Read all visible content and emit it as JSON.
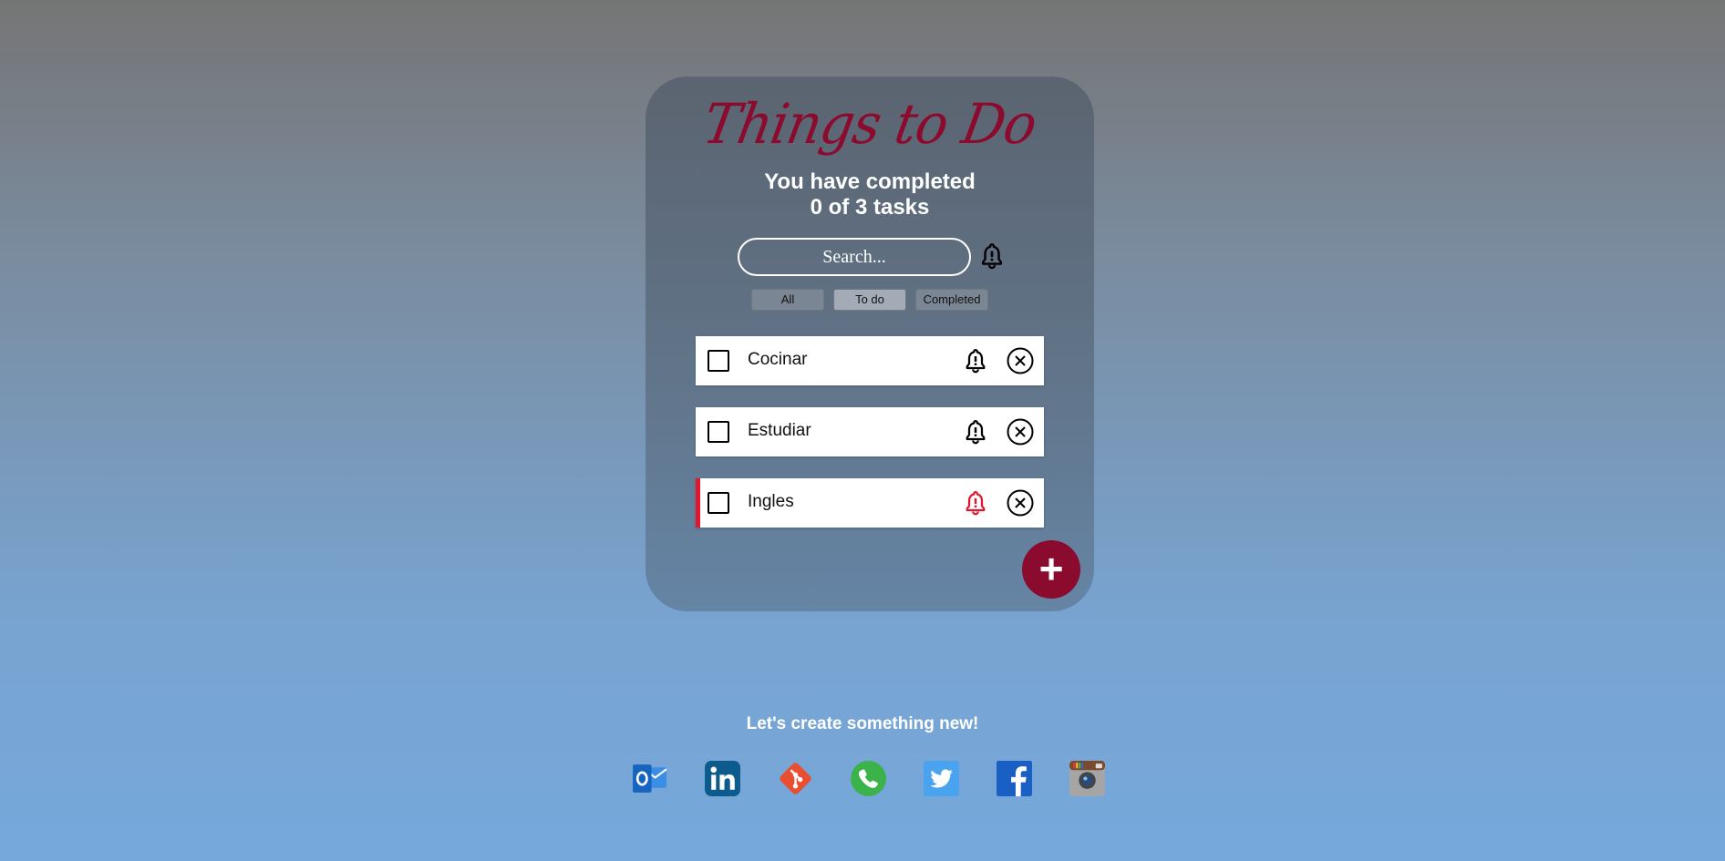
{
  "app": {
    "title": "Things to Do",
    "progress_line1": "You have completed",
    "progress_line2": "0 of 3 tasks"
  },
  "search": {
    "placeholder": "Search..."
  },
  "filters": [
    {
      "label": "All",
      "active": false
    },
    {
      "label": "To do",
      "active": true
    },
    {
      "label": "Completed",
      "active": false
    }
  ],
  "tasks": [
    {
      "label": "Cocinar",
      "completed": false,
      "reminder": false
    },
    {
      "label": "Estudiar",
      "completed": false,
      "reminder": false
    },
    {
      "label": "Ingles",
      "completed": false,
      "reminder": true
    }
  ],
  "add_button": {
    "symbol": "+"
  },
  "footer": {
    "tagline": "Let's create something new!",
    "socials": [
      "outlook-icon",
      "linkedin-icon",
      "git-icon",
      "whatsapp-icon",
      "twitter-icon",
      "facebook-icon",
      "instagram-icon"
    ]
  },
  "colors": {
    "accent": "#8b0b2e",
    "alert": "#e3162e",
    "card": "#5f6f80"
  }
}
